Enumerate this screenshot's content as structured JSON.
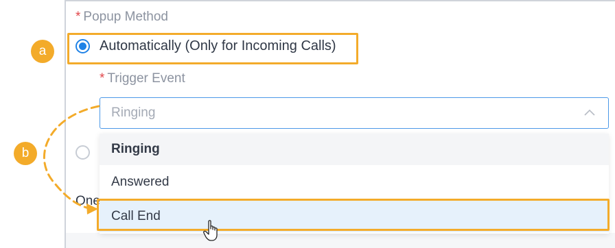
{
  "form": {
    "required_mark": "*",
    "popup_method_label": "Popup Method",
    "options": [
      {
        "label": "Automatically (Only for Incoming Calls)",
        "selected": true
      },
      {
        "label": "",
        "selected": false
      }
    ],
    "trigger_event_label": "Trigger Event",
    "trigger_select": {
      "value": "Ringing",
      "expanded": true
    },
    "dropdown_items": [
      {
        "label": "Ringing",
        "selected": true
      },
      {
        "label": "Answered",
        "selected": false
      },
      {
        "label": "Call End",
        "selected": false,
        "hovered": true
      }
    ],
    "partial_text": "One"
  },
  "annotations": {
    "badge_a": "a",
    "badge_b": "b",
    "highlight_color": "#f3ab2a"
  },
  "colors": {
    "accent": "#1f82e6",
    "required": "#e1464a",
    "hover_bg": "#e6f1fb"
  },
  "icons": [
    "chevron-up-icon",
    "hand-cursor-icon",
    "dashed-curve-arrow"
  ]
}
